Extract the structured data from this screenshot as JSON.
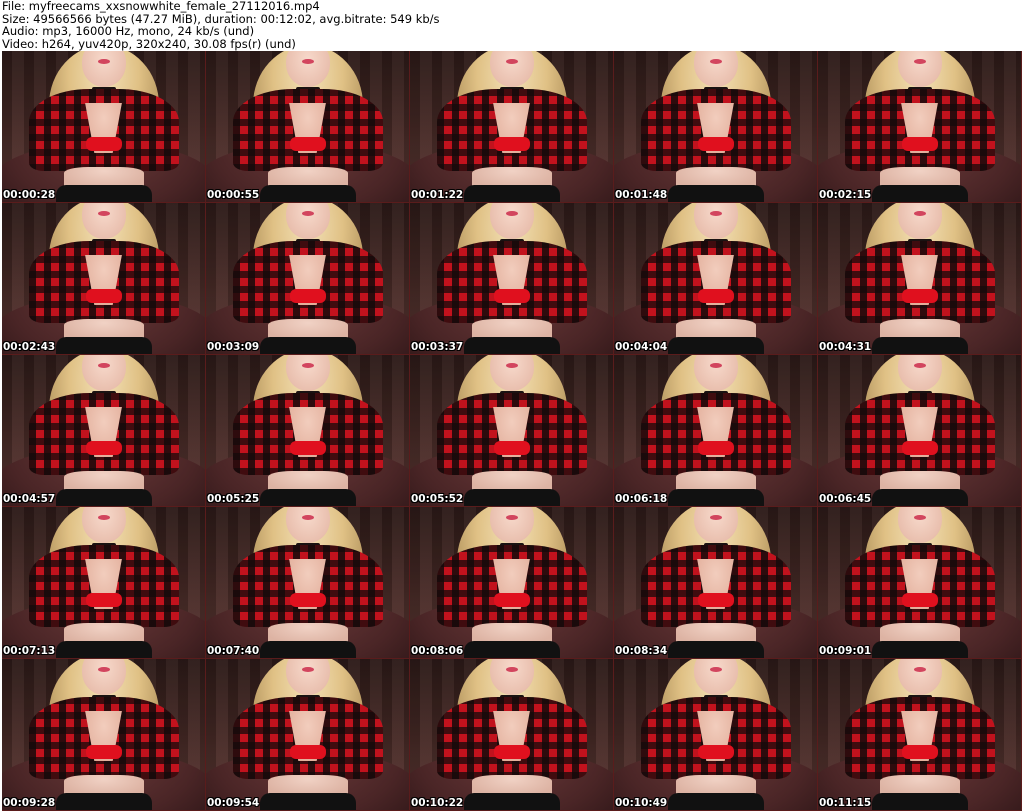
{
  "file_info": {
    "file": "File: myfreecams_xxsnowwhite_female_27112016.mp4",
    "size": "Size: 49566566 bytes (47.27 MiB), duration: 00:12:02, avg.bitrate: 549 kb/s",
    "audio": "Audio: mp3, 16000 Hz, mono, 24 kb/s (und)",
    "video": "Video: h264, yuv420p, 320x240, 30.08 fps(r) (und)"
  },
  "thumbnails": [
    {
      "timestamp": "00:00:28"
    },
    {
      "timestamp": "00:00:55"
    },
    {
      "timestamp": "00:01:22"
    },
    {
      "timestamp": "00:01:48"
    },
    {
      "timestamp": "00:02:15"
    },
    {
      "timestamp": "00:02:43"
    },
    {
      "timestamp": "00:03:09"
    },
    {
      "timestamp": "00:03:37"
    },
    {
      "timestamp": "00:04:04"
    },
    {
      "timestamp": "00:04:31"
    },
    {
      "timestamp": "00:04:57"
    },
    {
      "timestamp": "00:05:25"
    },
    {
      "timestamp": "00:05:52"
    },
    {
      "timestamp": "00:06:18"
    },
    {
      "timestamp": "00:06:45"
    },
    {
      "timestamp": "00:07:13"
    },
    {
      "timestamp": "00:07:40"
    },
    {
      "timestamp": "00:08:06"
    },
    {
      "timestamp": "00:08:34"
    },
    {
      "timestamp": "00:09:01"
    },
    {
      "timestamp": "00:09:28"
    },
    {
      "timestamp": "00:09:54"
    },
    {
      "timestamp": "00:10:22"
    },
    {
      "timestamp": "00:10:49"
    },
    {
      "timestamp": "00:11:15"
    }
  ]
}
